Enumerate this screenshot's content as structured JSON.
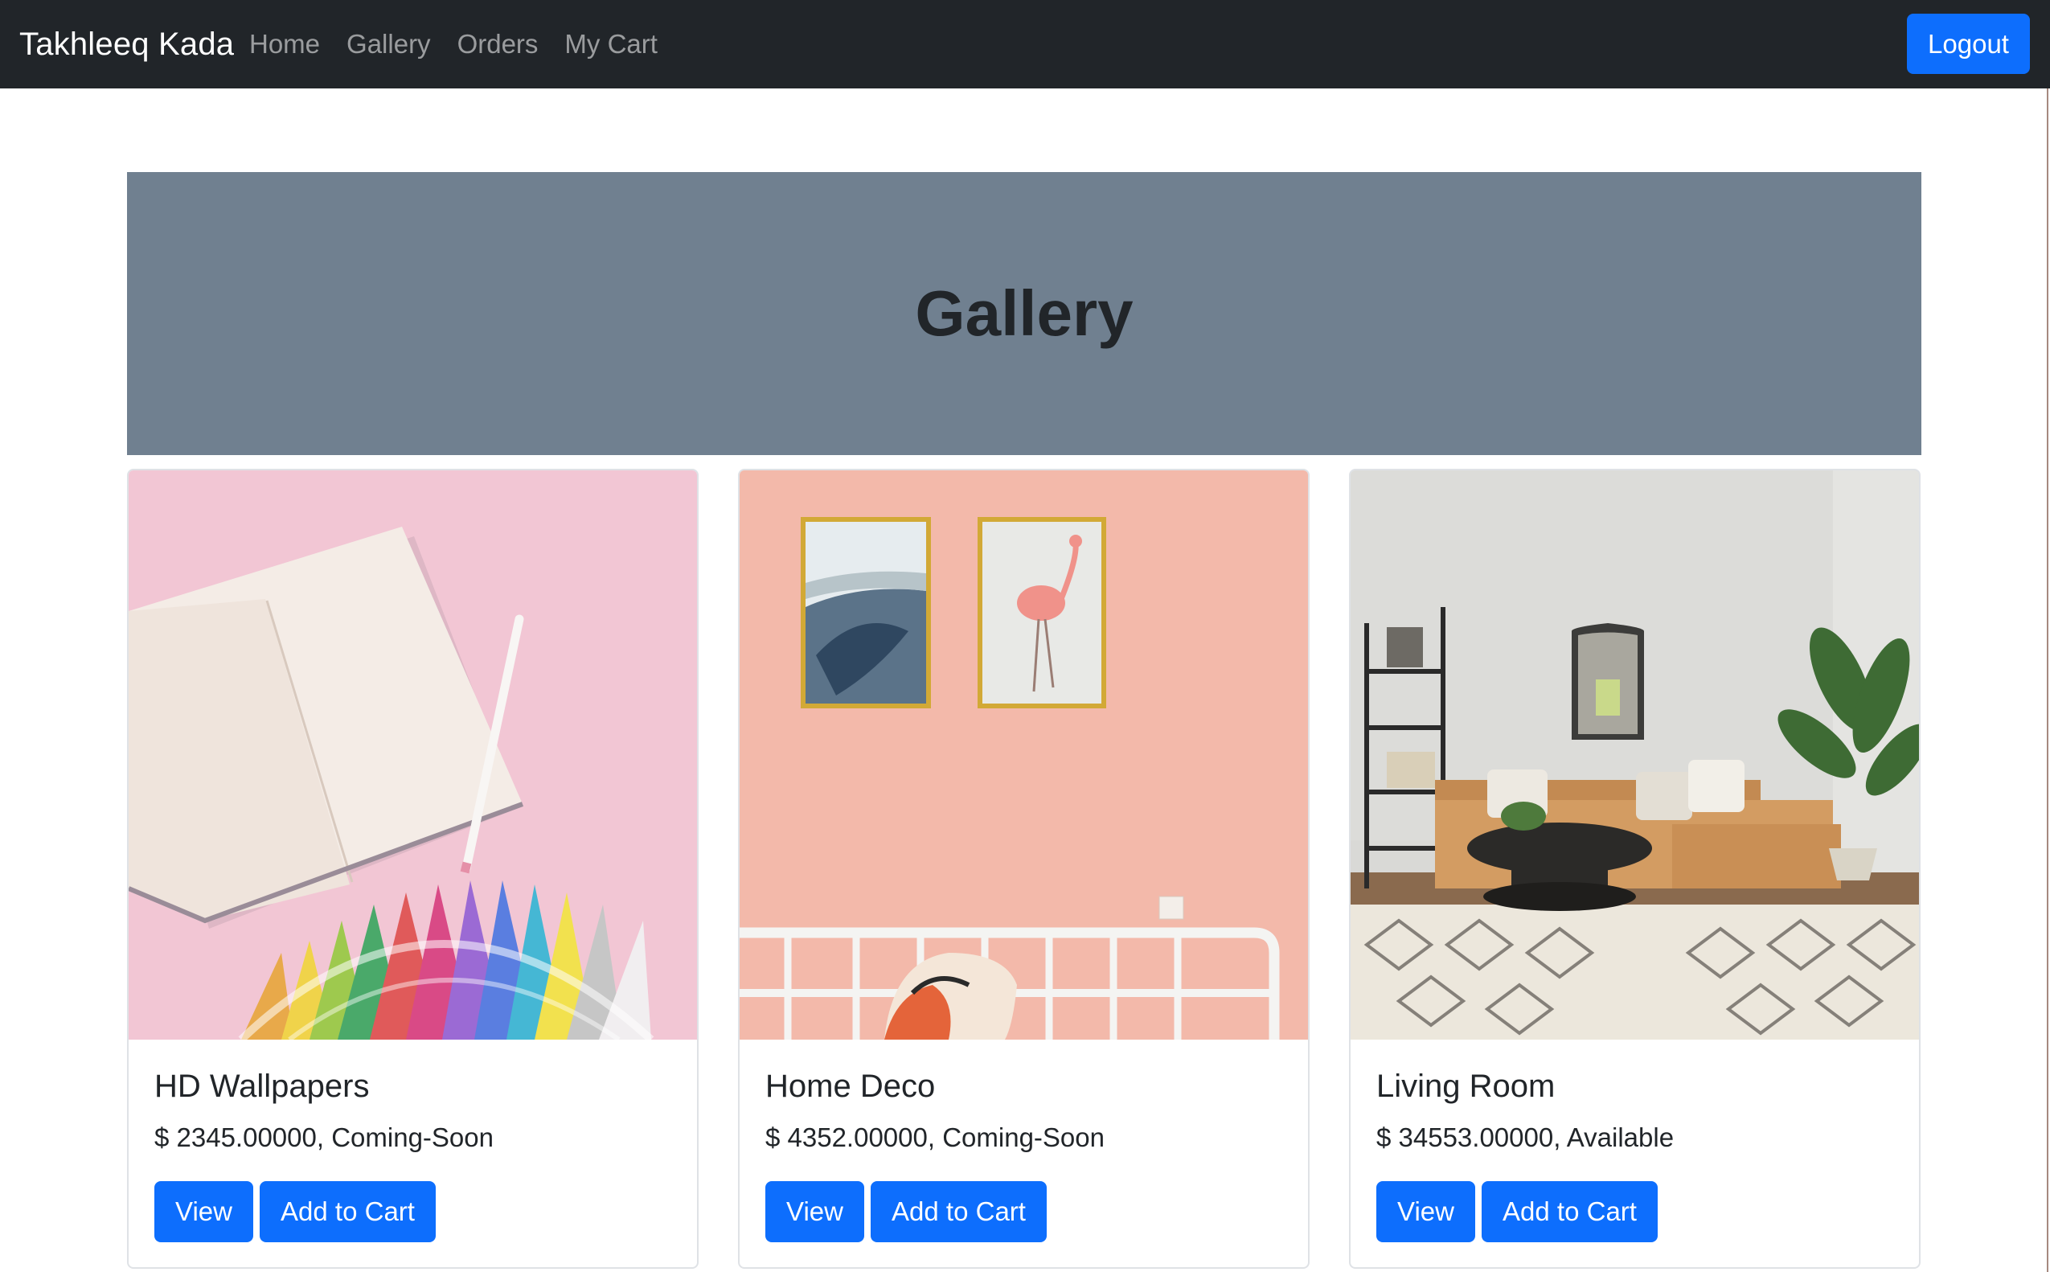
{
  "navbar": {
    "brand": "Takhleeq Kada",
    "links": [
      "Home",
      "Gallery",
      "Orders",
      "My Cart"
    ],
    "logout_label": "Logout"
  },
  "banner": {
    "title": "Gallery"
  },
  "products": [
    {
      "name": "HD Wallpapers",
      "price_status": "$ 2345.00000, Coming-Soon",
      "view_label": "View",
      "cart_label": "Add to Cart"
    },
    {
      "name": "Home Deco",
      "price_status": "$ 4352.00000, Coming-Soon",
      "view_label": "View",
      "cart_label": "Add to Cart"
    },
    {
      "name": "Living Room",
      "price_status": "$ 34553.00000, Available",
      "view_label": "View",
      "cart_label": "Add to Cart"
    }
  ],
  "colors": {
    "navbar_bg": "#212529",
    "primary": "#0d6efd",
    "banner_bg": "#708090"
  }
}
